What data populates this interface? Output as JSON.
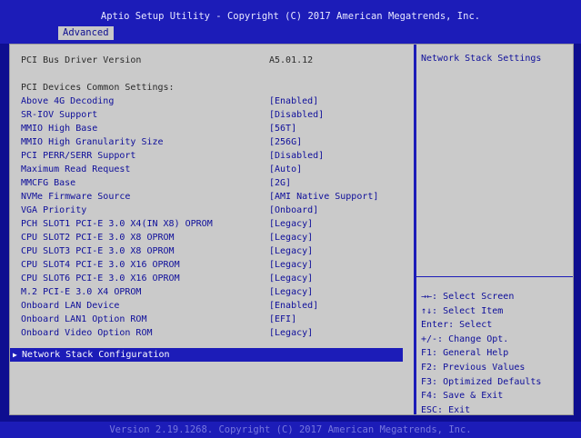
{
  "header": {
    "title": "Aptio Setup Utility - Copyright (C) 2017 American Megatrends, Inc.",
    "active_tab": "Advanced"
  },
  "info": {
    "label": "PCI Bus Driver Version",
    "value": "A5.01.12"
  },
  "section_heading": "PCI Devices Common Settings:",
  "settings": [
    {
      "label": "Above 4G Decoding",
      "value": "[Enabled]"
    },
    {
      "label": "SR-IOV Support",
      "value": "[Disabled]"
    },
    {
      "label": "MMIO High Base",
      "value": "[56T]"
    },
    {
      "label": "MMIO High Granularity Size",
      "value": "[256G]"
    },
    {
      "label": "PCI PERR/SERR Support",
      "value": "[Disabled]"
    },
    {
      "label": "Maximum Read Request",
      "value": "[Auto]"
    },
    {
      "label": "MMCFG Base",
      "value": "[2G]"
    },
    {
      "label": "NVMe Firmware Source",
      "value": "[AMI Native Support]"
    },
    {
      "label": "VGA Priority",
      "value": "[Onboard]"
    },
    {
      "label": "PCH SLOT1 PCI-E 3.0 X4(IN X8) OPROM",
      "value": "[Legacy]"
    },
    {
      "label": "CPU SLOT2 PCI-E 3.0 X8 OPROM",
      "value": "[Legacy]"
    },
    {
      "label": "CPU SLOT3 PCI-E 3.0 X8 OPROM",
      "value": "[Legacy]"
    },
    {
      "label": "CPU SLOT4 PCI-E 3.0 X16 OPROM",
      "value": "[Legacy]"
    },
    {
      "label": "CPU SLOT6 PCI-E 3.0 X16 OPROM",
      "value": "[Legacy]"
    },
    {
      "label": "M.2 PCI-E 3.0 X4 OPROM",
      "value": "[Legacy]"
    },
    {
      "label": "Onboard LAN Device",
      "value": "[Enabled]"
    },
    {
      "label": "Onboard LAN1 Option ROM",
      "value": "[EFI]"
    },
    {
      "label": "Onboard Video Option ROM",
      "value": "[Legacy]"
    }
  ],
  "submenu": {
    "marker": "▶",
    "label": "Network Stack Configuration"
  },
  "help": {
    "title": "Network Stack Settings",
    "keys": [
      "→←: Select Screen",
      "↑↓: Select Item",
      "Enter: Select",
      "+/-: Change Opt.",
      "F1: General Help",
      "F2: Previous Values",
      "F3: Optimized Defaults",
      "F4: Save & Exit",
      "ESC: Exit"
    ]
  },
  "footer": "Version 2.19.1268. Copyright (C) 2017 American Megatrends, Inc.",
  "colors": {
    "background": "#0e0e90",
    "header_blue": "#1c1cb8",
    "panel_gray": "#cacaca",
    "link_blue": "#0e0e9a",
    "highlight": "#1c1cb8"
  }
}
